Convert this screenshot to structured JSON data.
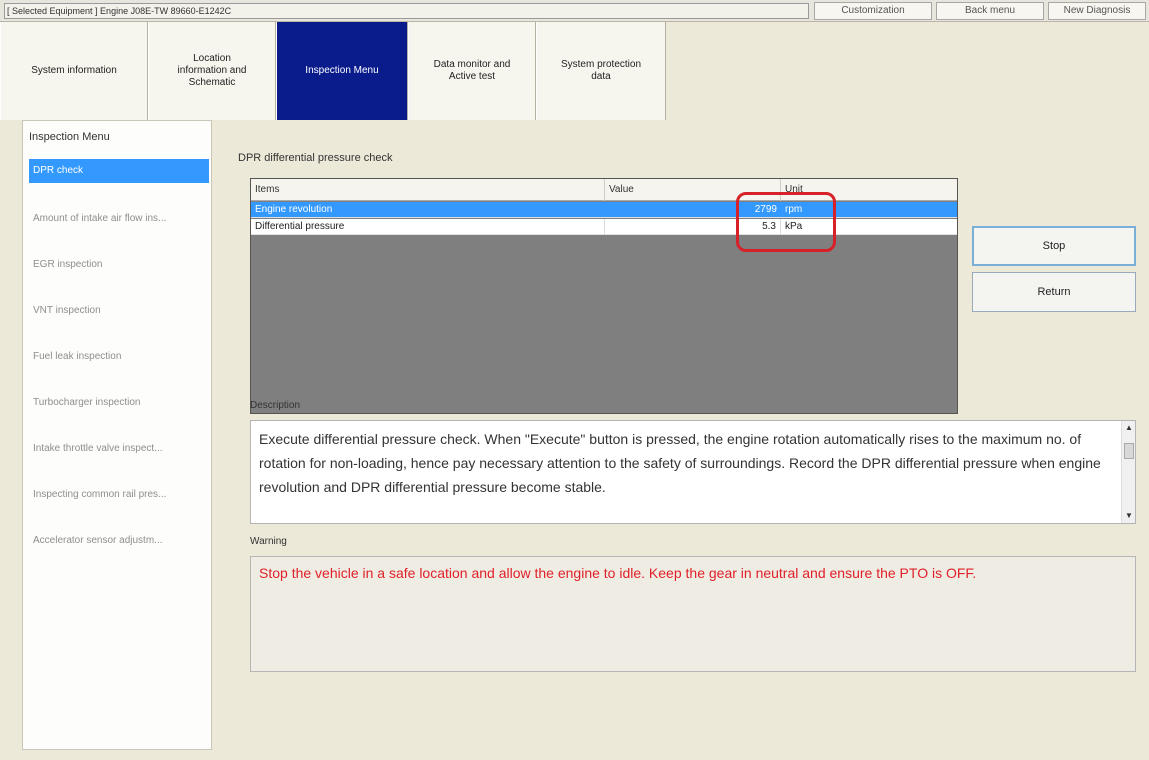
{
  "header": {
    "selected_equipment": "[ Selected Equipment ] Engine J08E-TW 89660-E1242C",
    "buttons": [
      "Customization",
      "Back menu",
      "New Diagnosis"
    ]
  },
  "tabs": [
    {
      "label": "System information"
    },
    {
      "label": "Location\ninformation and\nSchematic"
    },
    {
      "label": "Inspection Menu",
      "active": true
    },
    {
      "label": "Data monitor and\nActive test"
    },
    {
      "label": "System protection\ndata"
    }
  ],
  "sidebar": {
    "title": "Inspection Menu",
    "items": [
      {
        "label": "DPR check",
        "active": true
      },
      {
        "label": "Amount of intake air flow ins..."
      },
      {
        "label": "EGR inspection"
      },
      {
        "label": "VNT inspection"
      },
      {
        "label": "Fuel leak inspection"
      },
      {
        "label": "Turbocharger inspection"
      },
      {
        "label": "Intake throttle valve inspect..."
      },
      {
        "label": "Inspecting common rail pres..."
      },
      {
        "label": "Accelerator sensor adjustm..."
      }
    ]
  },
  "main": {
    "section_title": "DPR differential pressure check",
    "table": {
      "columns": [
        "Items",
        "Value",
        "Unit"
      ],
      "rows": [
        {
          "item": "Engine revolution",
          "value": "2799",
          "unit": "rpm",
          "selected": true
        },
        {
          "item": "Differential pressure",
          "value": "5.3",
          "unit": "kPa"
        }
      ]
    },
    "buttons": {
      "stop": "Stop",
      "return": "Return"
    },
    "description_label": "Description",
    "description": "Execute differential pressure check. When \"Execute\" button is pressed, the engine rotation automatically rises to the maximum no. of rotation for non-loading, hence pay necessary attention to the safety of surroundings. Record the DPR differential pressure when engine revolution and DPR differential pressure become stable.",
    "warning_label": "Warning",
    "warning": "Stop the vehicle in a safe location and allow the engine to idle. Keep the gear in neutral and ensure the PTO is OFF."
  },
  "colors": {
    "active_tab": "#0a1c8c",
    "selection": "#3399ff",
    "highlight": "#d6202a",
    "warning_text": "#e0202a"
  }
}
